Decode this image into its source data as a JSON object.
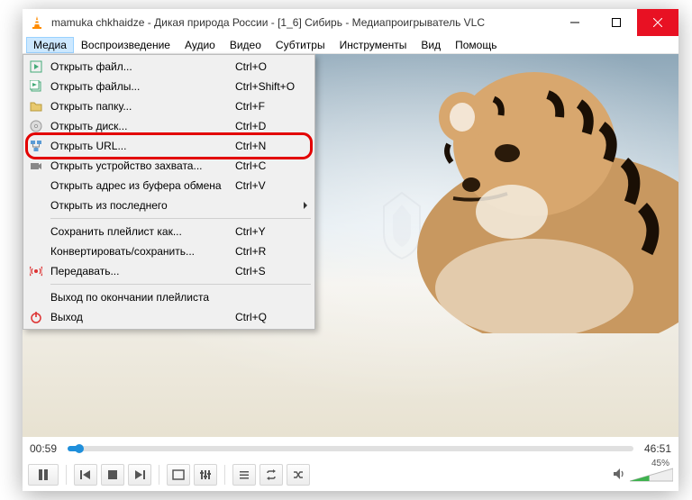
{
  "titlebar": {
    "title": "mamuka chkhaidze - Дикая природа России - [1_6] Сибирь - Медиапроигрыватель VLC"
  },
  "menubar": {
    "items": [
      "Медиа",
      "Воспроизведение",
      "Аудио",
      "Видео",
      "Субтитры",
      "Инструменты",
      "Вид",
      "Помощь"
    ]
  },
  "dropdown": {
    "groups": [
      [
        {
          "icon": "play-file",
          "label": "Открыть файл...",
          "shortcut": "Ctrl+O"
        },
        {
          "icon": "play-files",
          "label": "Открыть файлы...",
          "shortcut": "Ctrl+Shift+O"
        },
        {
          "icon": "folder",
          "label": "Открыть папку...",
          "shortcut": "Ctrl+F"
        },
        {
          "icon": "disc",
          "label": "Открыть диск...",
          "shortcut": "Ctrl+D"
        },
        {
          "icon": "network",
          "label": "Открыть URL...",
          "shortcut": "Ctrl+N",
          "highlighted": true
        },
        {
          "icon": "capture",
          "label": "Открыть устройство захвата...",
          "shortcut": "Ctrl+C"
        },
        {
          "icon": "",
          "label": "Открыть адрес из буфера обмена",
          "shortcut": "Ctrl+V"
        },
        {
          "icon": "",
          "label": "Открыть из последнего",
          "submenu": true
        }
      ],
      [
        {
          "icon": "",
          "label": "Сохранить плейлист как...",
          "shortcut": "Ctrl+Y"
        },
        {
          "icon": "",
          "label": "Конвертировать/сохранить...",
          "shortcut": "Ctrl+R"
        },
        {
          "icon": "stream",
          "label": "Передавать...",
          "shortcut": "Ctrl+S"
        }
      ],
      [
        {
          "icon": "",
          "label": "Выход по окончании плейлиста"
        },
        {
          "icon": "quit",
          "label": "Выход",
          "shortcut": "Ctrl+Q"
        }
      ]
    ]
  },
  "playback": {
    "current_time": "00:59",
    "total_time": "46:51",
    "progress_pct": 2.1,
    "volume_pct": 45,
    "volume_label": "45%"
  },
  "colors": {
    "accent": "#1f8fdb",
    "highlight": "#e30000"
  }
}
